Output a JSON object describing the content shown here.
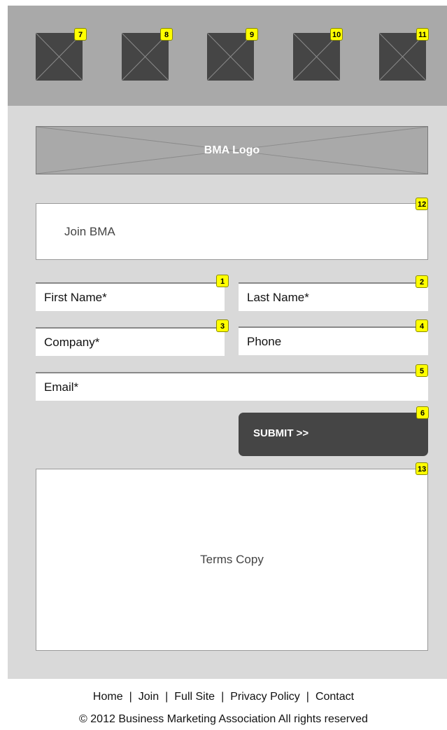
{
  "nav_thumbnails": [
    {
      "badge": "7"
    },
    {
      "badge": "8"
    },
    {
      "badge": "9"
    },
    {
      "badge": "10"
    },
    {
      "badge": "11"
    }
  ],
  "logo": {
    "label": "BMA Logo"
  },
  "join": {
    "label": "Join BMA",
    "badge": "12"
  },
  "form": {
    "first_name": {
      "label": "First Name*",
      "badge": "1"
    },
    "last_name": {
      "label": "Last Name*",
      "badge": "2"
    },
    "company": {
      "label": "Company*",
      "badge": "3"
    },
    "phone": {
      "label": "Phone",
      "badge": "4"
    },
    "email": {
      "label": "Email*",
      "badge": "5"
    },
    "submit": {
      "label": "SUBMIT >>",
      "badge": "6"
    }
  },
  "terms": {
    "label": "Terms Copy",
    "badge": "13"
  },
  "footer": {
    "links": [
      "Home",
      "Join",
      "Full Site",
      "Privacy Policy",
      "Contact"
    ],
    "separator": "|",
    "copyright": "© 2012 Business Marketing Association All rights reserved"
  },
  "colors": {
    "badge": "#ffff00",
    "header_band": "#a9a9a9",
    "panel": "#d9d9d9",
    "button": "#454545"
  }
}
